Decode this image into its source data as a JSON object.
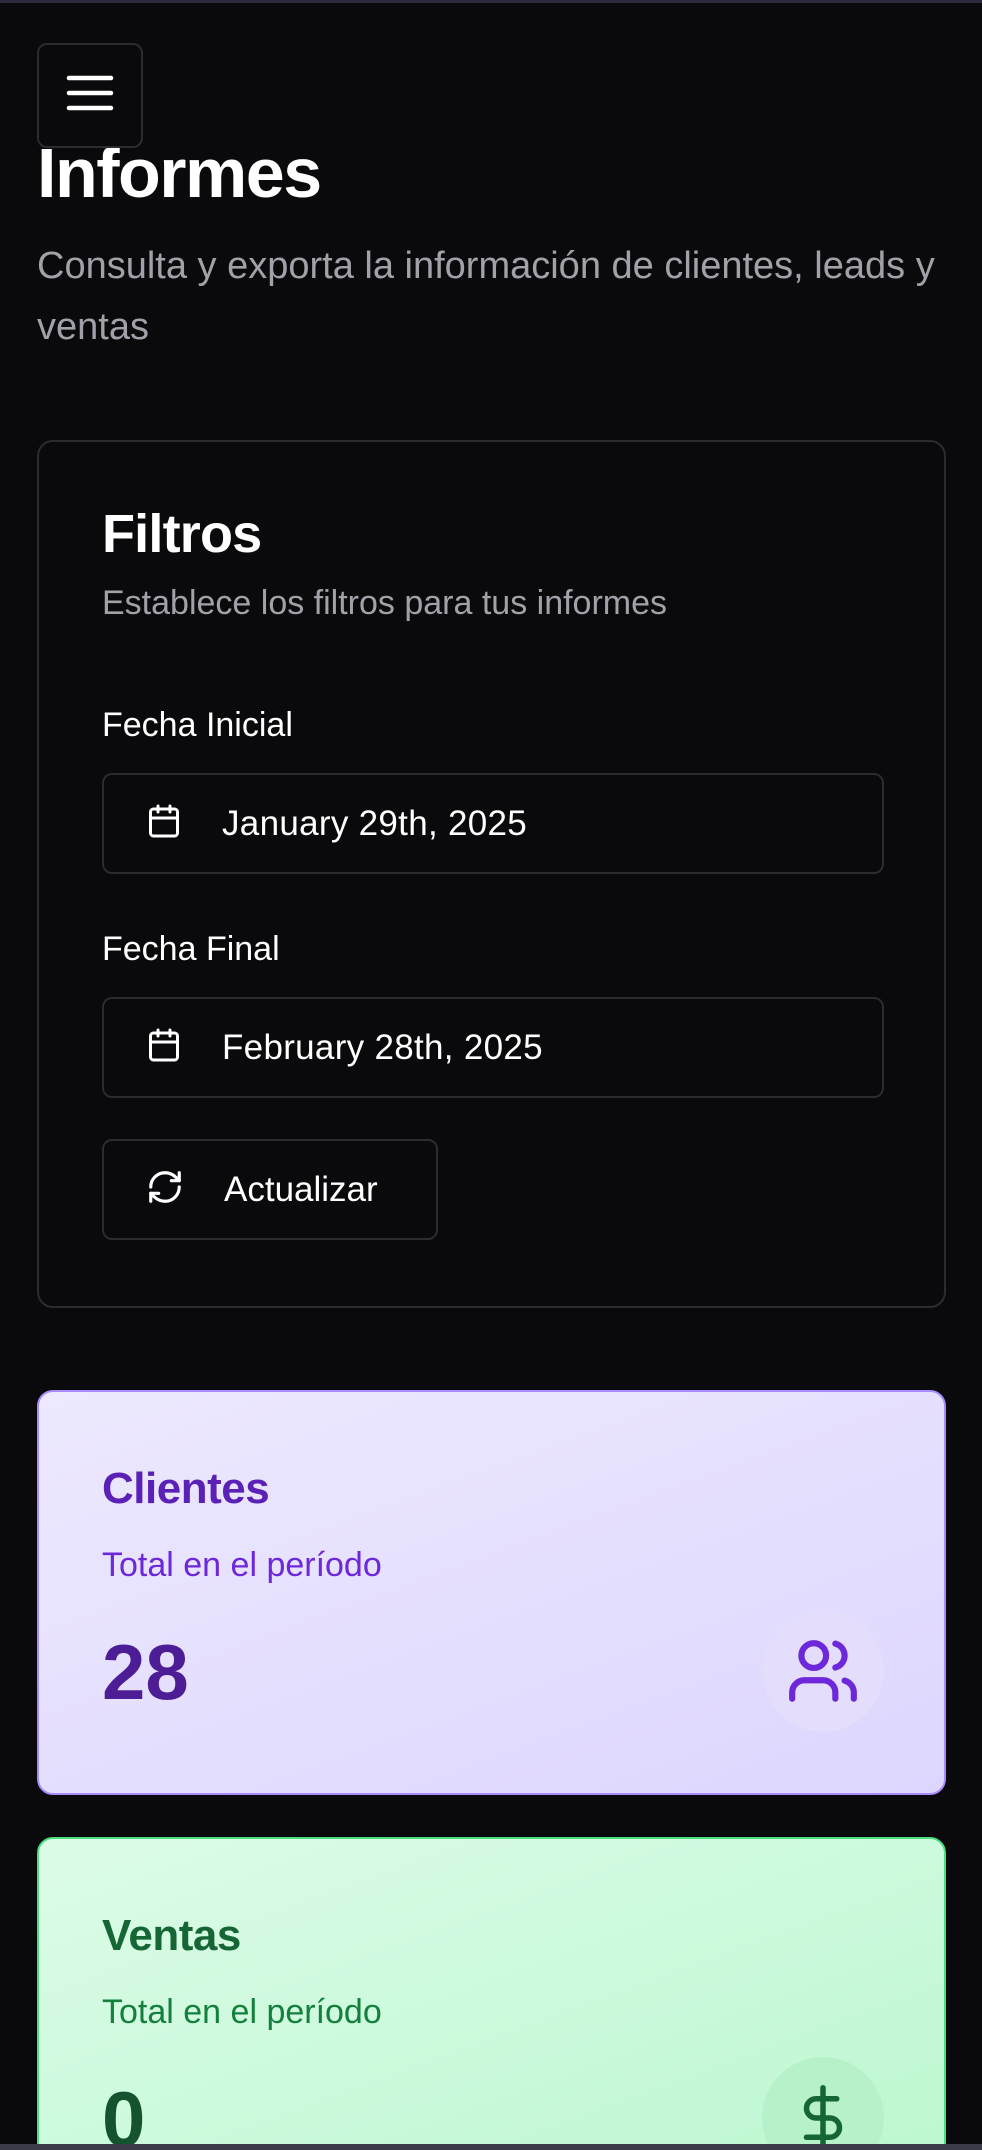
{
  "header": {
    "menu_icon": "hamburger-menu-icon",
    "title": "Informes",
    "subtitle": "Consulta y exporta la información de clientes, leads y ventas"
  },
  "filters": {
    "title": "Filtros",
    "description": "Establece los filtros para tus informes",
    "start_date": {
      "label": "Fecha Inicial",
      "value": "January 29th, 2025",
      "icon": "calendar-icon"
    },
    "end_date": {
      "label": "Fecha Final",
      "value": "February 28th, 2025",
      "icon": "calendar-icon"
    },
    "refresh": {
      "label": "Actualizar",
      "icon": "refresh-icon"
    }
  },
  "stats": {
    "clients": {
      "title": "Clientes",
      "description": "Total en el período",
      "value": "28",
      "icon": "users-icon",
      "accent": "#5b21b6"
    },
    "sales": {
      "title": "Ventas",
      "description": "Total en el período",
      "value": "0",
      "icon": "dollar-icon",
      "accent": "#166534"
    }
  }
}
